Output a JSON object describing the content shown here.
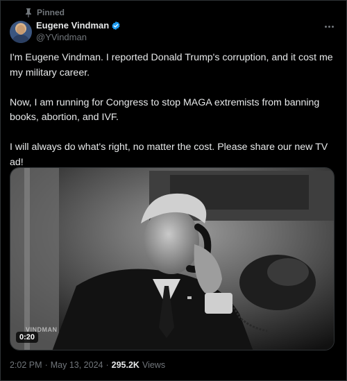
{
  "pinned_label": "Pinned",
  "author": {
    "name": "Eugene Vindman",
    "handle": "@YVindman",
    "verified": true
  },
  "tweet": {
    "paragraphs": [
      "I'm Eugene Vindman. I reported Donald Trump's corruption, and it cost me my military career.",
      "Now, I am running for Congress to stop MAGA extremists from banning books, abortion, and IVF.",
      "I will always do what's right, no matter the cost. Please share our new TV ad!"
    ]
  },
  "media": {
    "duration": "0:20",
    "watermark": "VINDMAN"
  },
  "meta": {
    "time": "2:02 PM",
    "separator": "·",
    "date": "May 13, 2024",
    "views_count": "295.2K",
    "views_label": "Views"
  },
  "colors": {
    "background": "#000000",
    "text": "#e7e9ea",
    "muted": "#71767b",
    "verified_blue": "#1d9bf0"
  }
}
